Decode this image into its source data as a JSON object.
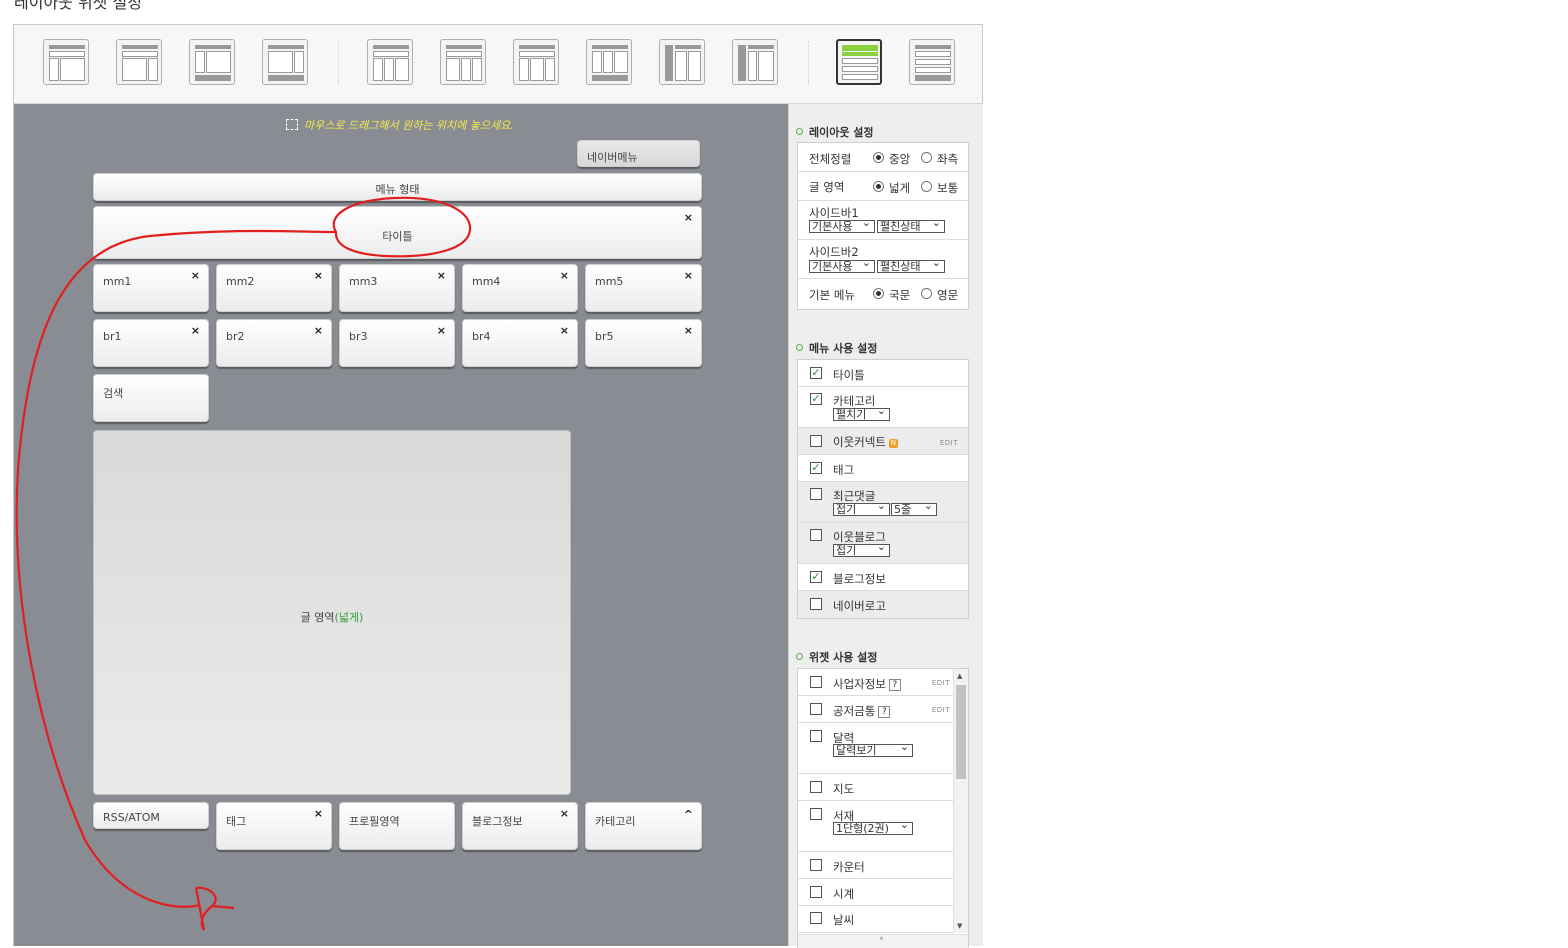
{
  "page": {
    "heading": "레이아웃 위젯 설정"
  },
  "toolbar": {
    "layouts": [
      {
        "name": "layout-1"
      },
      {
        "name": "layout-2"
      },
      {
        "name": "layout-3"
      },
      {
        "name": "layout-4"
      },
      {
        "name": "layout-5"
      },
      {
        "name": "layout-6"
      },
      {
        "name": "layout-7"
      },
      {
        "name": "layout-8"
      },
      {
        "name": "layout-9"
      },
      {
        "name": "layout-10"
      },
      {
        "name": "layout-11"
      },
      {
        "name": "layout-12"
      }
    ],
    "active_color": "#8bd13f"
  },
  "canvas": {
    "hint": "마우스로 드래그해서 원하는 위치에 놓으세요.",
    "naver_menu": "네이버메뉴",
    "menu_type": "메뉴 형태",
    "title": "타이틀",
    "row1": [
      "mm1",
      "mm2",
      "mm3",
      "mm4",
      "mm5"
    ],
    "row2": [
      "br1",
      "br2",
      "br3",
      "br4",
      "br5"
    ],
    "search": "검색",
    "content_label": "글 영역",
    "content_paren": "(넓게)",
    "bottom": [
      "RSS/ATOM",
      "태그",
      "프로필영역",
      "블로그정보",
      "카테고리"
    ],
    "close_symbol": "×",
    "collapse_symbol": "^"
  },
  "sidebar": {
    "layout": {
      "title": "레이아웃 설정",
      "align": {
        "label": "전체정렬",
        "opt1": "중앙",
        "opt2": "좌측"
      },
      "area": {
        "label": "글 영역",
        "opt1": "넓게",
        "opt2": "보통"
      },
      "sidebar1": {
        "label": "사이드바1",
        "sel1": "기본사용",
        "sel2": "펼친상태"
      },
      "sidebar2": {
        "label": "사이드바2",
        "sel1": "기본사용",
        "sel2": "펼친상태"
      },
      "menu": {
        "label": "기본 메뉴",
        "opt1": "국문",
        "opt2": "영문"
      }
    },
    "menu": {
      "title": "메뉴 사용 설정",
      "items": [
        {
          "label": "타이틀",
          "checked": true
        },
        {
          "label": "카테고리",
          "checked": true,
          "sel": "펼치기"
        },
        {
          "label": "이웃커넥트",
          "checked": false,
          "badge": "N",
          "edit": "EDIT"
        },
        {
          "label": "태그",
          "checked": true
        },
        {
          "label": "최근댓글",
          "checked": false,
          "sel": "접기",
          "sel2": "5줄"
        },
        {
          "label": "이웃블로그",
          "checked": false,
          "sel": "접기"
        },
        {
          "label": "블로그정보",
          "checked": true
        },
        {
          "label": "네이버로고",
          "checked": false
        }
      ]
    },
    "widget": {
      "title": "위젯 사용 설정",
      "items": [
        {
          "label": "사업자정보",
          "help": "?",
          "edit": "EDIT"
        },
        {
          "label": "공저금통",
          "help": "?",
          "edit": "EDIT"
        },
        {
          "label": "달력",
          "sel": "달력보기"
        },
        {
          "label": "지도"
        },
        {
          "label": "서재",
          "sel": "1단형(2권)"
        },
        {
          "label": "카운터"
        },
        {
          "label": "시계"
        },
        {
          "label": "날씨"
        }
      ]
    }
  }
}
